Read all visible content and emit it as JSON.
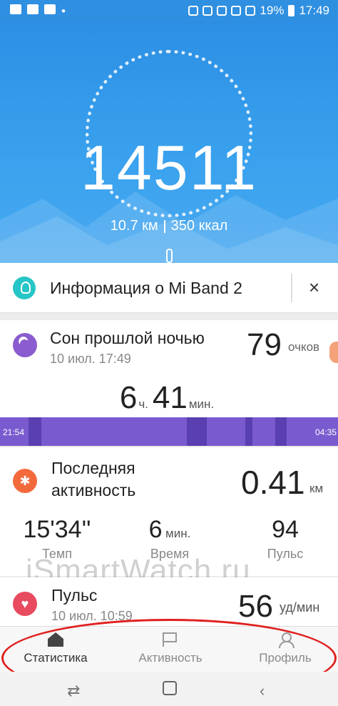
{
  "status_bar": {
    "battery": "19%",
    "time": "17:49"
  },
  "hero": {
    "steps": "14511",
    "distance": "10.7 км",
    "calories": "350 ккал"
  },
  "info_card": {
    "title": "Информация о Mi Band 2",
    "close": "×"
  },
  "sleep": {
    "title": "Сон прошлой ночью",
    "date": "10 июл. 17:49",
    "score": "79",
    "score_unit": "очков",
    "hours": "6",
    "hours_unit": "ч.",
    "minutes": "41",
    "minutes_unit": "мин.",
    "start": "21:54",
    "end": "04:35"
  },
  "activity": {
    "title": "Последняя активность",
    "distance": "0.41",
    "distance_unit": "км",
    "stats": [
      {
        "value": "15'34''",
        "unit": "",
        "label": "Темп"
      },
      {
        "value": "6",
        "unit": "мин.",
        "label": "Время"
      },
      {
        "value": "94",
        "unit": "",
        "label": "Пульс"
      }
    ]
  },
  "pulse": {
    "title": "Пульс",
    "date": "10 июл. 10:59",
    "value": "56",
    "unit": "уд/мин"
  },
  "watermark": "iSmartWatch.ru",
  "tabs": [
    {
      "label": "Статистика",
      "icon": "home-icon",
      "active": true
    },
    {
      "label": "Активность",
      "icon": "flag-icon",
      "active": false
    },
    {
      "label": "Профиль",
      "icon": "profile-icon",
      "active": false
    }
  ],
  "colors": {
    "hero": "#2c8fe4",
    "sleep": "#7a5bcf",
    "activity": "#f26a3c",
    "pulse": "#e84a5f",
    "highlight": "#e0201e"
  }
}
